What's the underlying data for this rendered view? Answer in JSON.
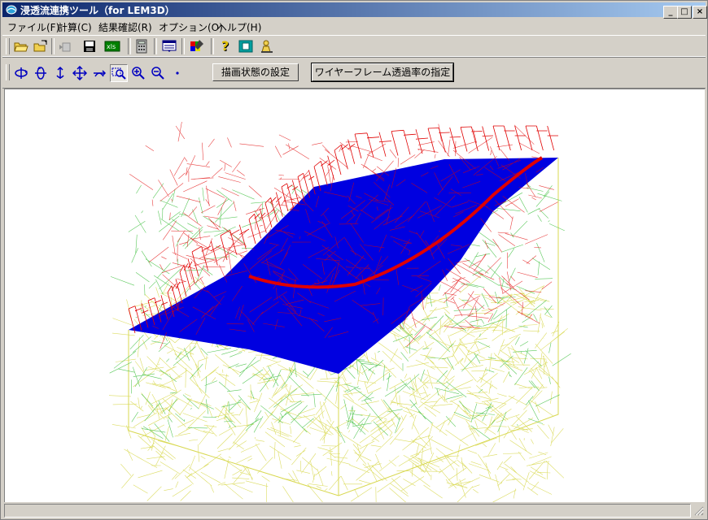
{
  "window": {
    "title": "浸透流連携ツール（for LEM3D）",
    "controls": {
      "minimize": "_",
      "maximize": "□",
      "close": "×"
    }
  },
  "menu": {
    "items": [
      "ファイル(F)",
      "計算(C)",
      "結果確認(R)",
      "オプション(O)",
      "ヘルプ(H)"
    ]
  },
  "toolbar": {
    "icons": [
      "open-folder-icon",
      "open-file-icon",
      "import-icon",
      "save-icon",
      "export-csv-icon",
      "calculator-icon",
      "list-view-icon",
      "color-palette-icon",
      "help-icon",
      "display-icon",
      "user-icon"
    ]
  },
  "view_toolbar": {
    "icons": [
      "rotate-x-icon",
      "rotate-y-icon",
      "rotate-vertical-icon",
      "pan-icon",
      "rotate-horizontal-icon",
      "zoom-window-icon",
      "zoom-in-icon",
      "zoom-out-icon",
      "point-icon"
    ],
    "pressed_index": 5,
    "draw_settings_label": "描画状態の設定",
    "wireframe_opacity_label": "ワイヤーフレーム透過率の指定"
  },
  "colors": {
    "title_start": "#0a246a",
    "title_end": "#a6caf0",
    "water_surface": "#0000e0",
    "wire_top": "#e00000",
    "wire_mid": "#40c040",
    "wire_low": "#d8d850"
  }
}
